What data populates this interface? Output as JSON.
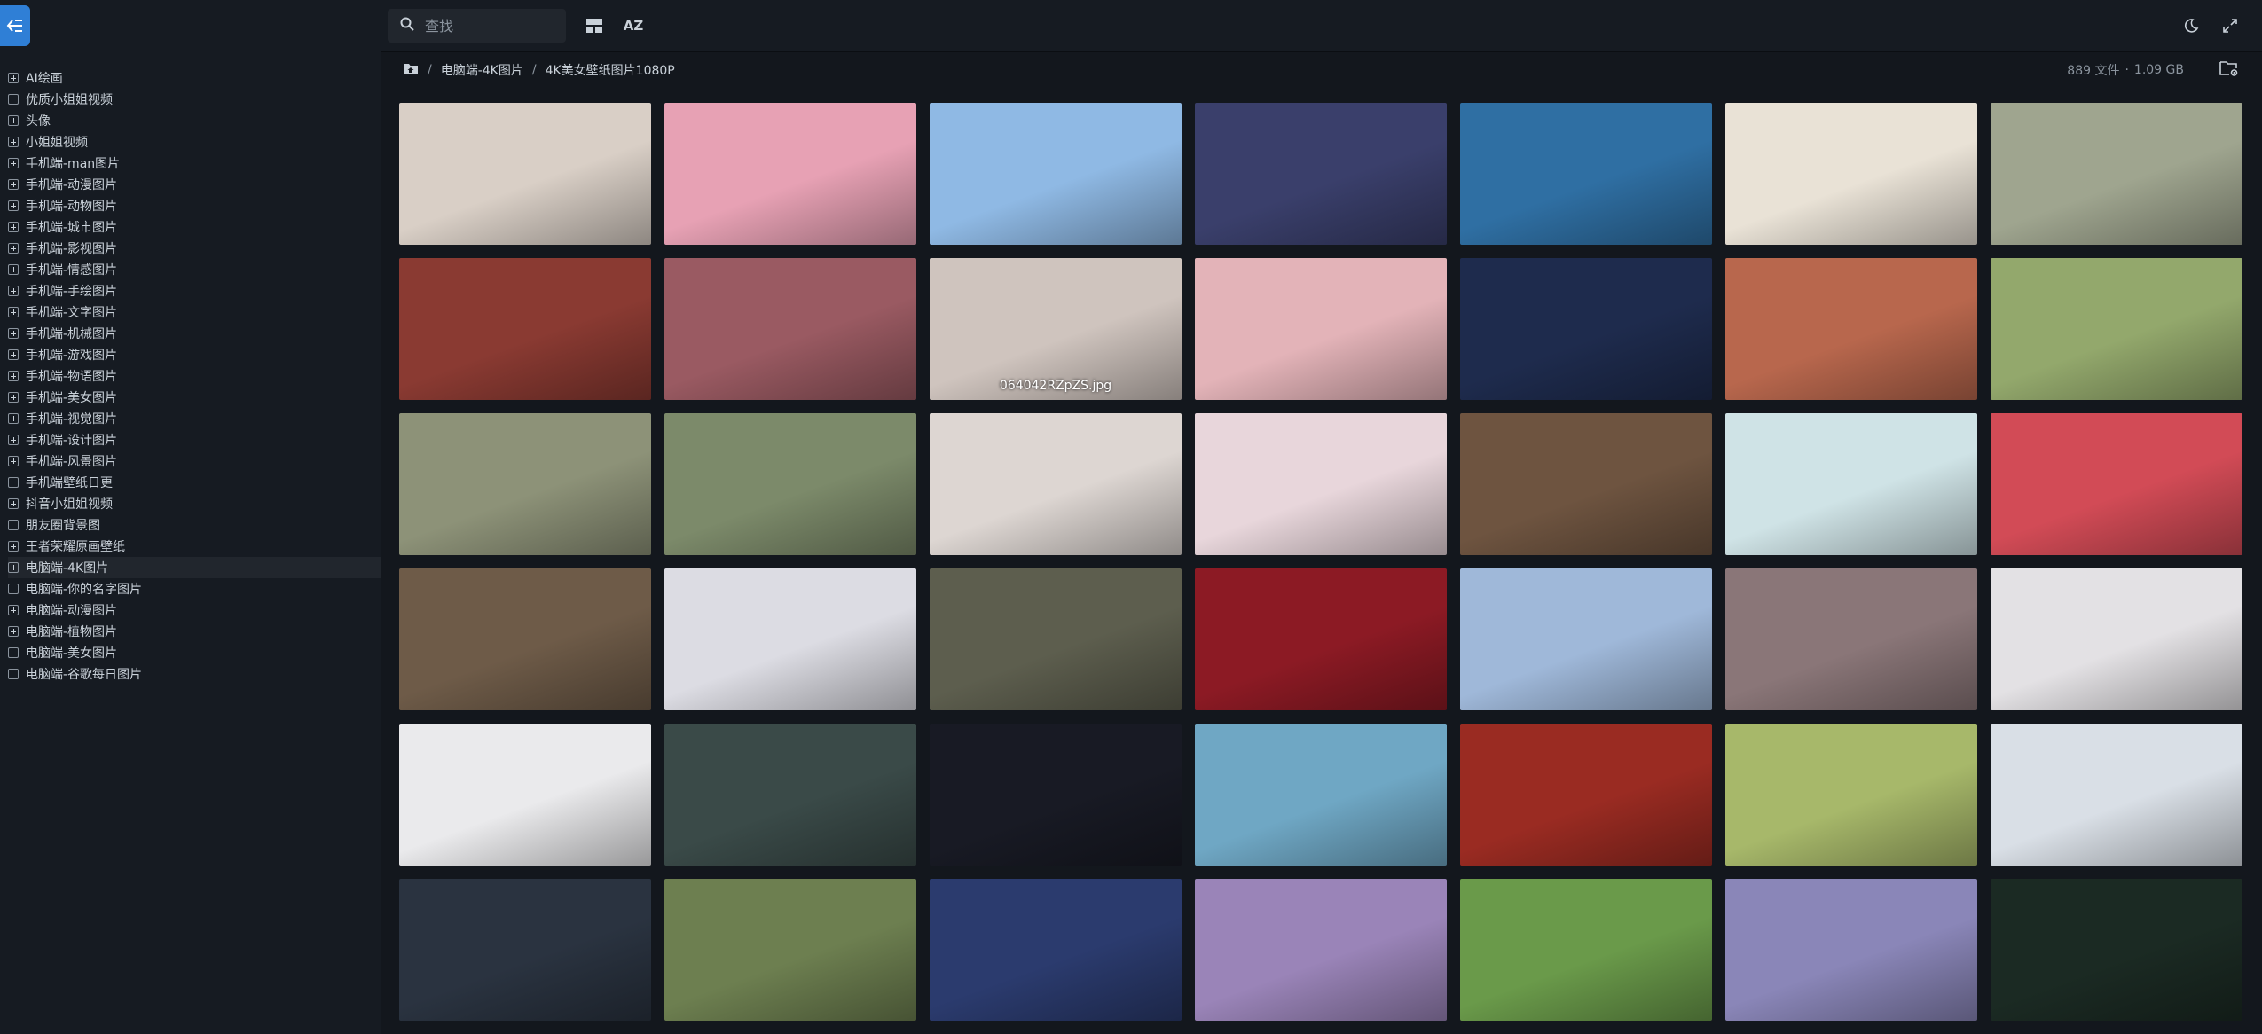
{
  "toolbar": {
    "search_placeholder": "查找",
    "sort_label": "AZ",
    "menu_icon": "arrow-left-menu-icon",
    "layout_icon": "grid-layout-icon",
    "theme_icon": "moon-icon",
    "fullscreen_icon": "fullscreen-icon"
  },
  "sidebar": {
    "items": [
      {
        "label": "AI绘画",
        "expandable": true
      },
      {
        "label": "优质小姐姐视频",
        "expandable": false
      },
      {
        "label": "头像",
        "expandable": true
      },
      {
        "label": "小姐姐视频",
        "expandable": true
      },
      {
        "label": "手机端-man图片",
        "expandable": true
      },
      {
        "label": "手机端-动漫图片",
        "expandable": true
      },
      {
        "label": "手机端-动物图片",
        "expandable": true
      },
      {
        "label": "手机端-城市图片",
        "expandable": true
      },
      {
        "label": "手机端-影视图片",
        "expandable": true
      },
      {
        "label": "手机端-情感图片",
        "expandable": true
      },
      {
        "label": "手机端-手绘图片",
        "expandable": true
      },
      {
        "label": "手机端-文字图片",
        "expandable": true
      },
      {
        "label": "手机端-机械图片",
        "expandable": true
      },
      {
        "label": "手机端-游戏图片",
        "expandable": true
      },
      {
        "label": "手机端-物语图片",
        "expandable": true
      },
      {
        "label": "手机端-美女图片",
        "expandable": true
      },
      {
        "label": "手机端-视觉图片",
        "expandable": true
      },
      {
        "label": "手机端-设计图片",
        "expandable": true
      },
      {
        "label": "手机端-风景图片",
        "expandable": true
      },
      {
        "label": "手机端壁纸日更",
        "expandable": false
      },
      {
        "label": "抖音小姐姐视频",
        "expandable": true
      },
      {
        "label": "朋友圈背景图",
        "expandable": false
      },
      {
        "label": "王者荣耀原画壁纸",
        "expandable": true
      },
      {
        "label": "电脑端-4K图片",
        "expandable": true,
        "active": true
      },
      {
        "label": "电脑端-你的名字图片",
        "expandable": false
      },
      {
        "label": "电脑端-动漫图片",
        "expandable": true
      },
      {
        "label": "电脑端-植物图片",
        "expandable": true
      },
      {
        "label": "电脑端-美女图片",
        "expandable": false
      },
      {
        "label": "电脑端-谷歌每日图片",
        "expandable": false
      }
    ]
  },
  "breadcrumb": {
    "home_icon": "home-folder-icon",
    "items": [
      "电脑端-4K图片",
      "4K美女壁纸图片1080P"
    ],
    "separator": "/"
  },
  "stats": {
    "files": "889 文件",
    "separator": "·",
    "size": "1.09 GB"
  },
  "gallery": {
    "hover_caption": "064042RZpZS.jpg",
    "hover_index": 9,
    "thumbs": [
      "#d9cfc6",
      "#e7a1b4",
      "#8fb9e4",
      "#3a3f6b",
      "#2f6fa3",
      "#e9e2d6",
      "#9fa58f",
      "#8a3a32",
      "#9a5a62",
      "#cfc4be",
      "#e3b3b8",
      "#1e2b4d",
      "#b8674d",
      "#93a86c",
      "#8d9278",
      "#7c8a6a",
      "#ddd6d2",
      "#e8d6db",
      "#6e5440",
      "#cfe3e6",
      "#d24b56",
      "#6e5b48",
      "#dcdce3",
      "#5d5e4e",
      "#8c1a24",
      "#9fb8d9",
      "#8a7678",
      "#e3e1e4",
      "#eaeaec",
      "#3a4a48",
      "#181a24",
      "#6fa7c4",
      "#9a2b22",
      "#a7b86a",
      "#d9dfe6",
      "#2a3340",
      "#6d7f50",
      "#2b3b6e",
      "#9a84b8",
      "#6a9a4a",
      "#8a86b8",
      "#1b2a23"
    ]
  }
}
